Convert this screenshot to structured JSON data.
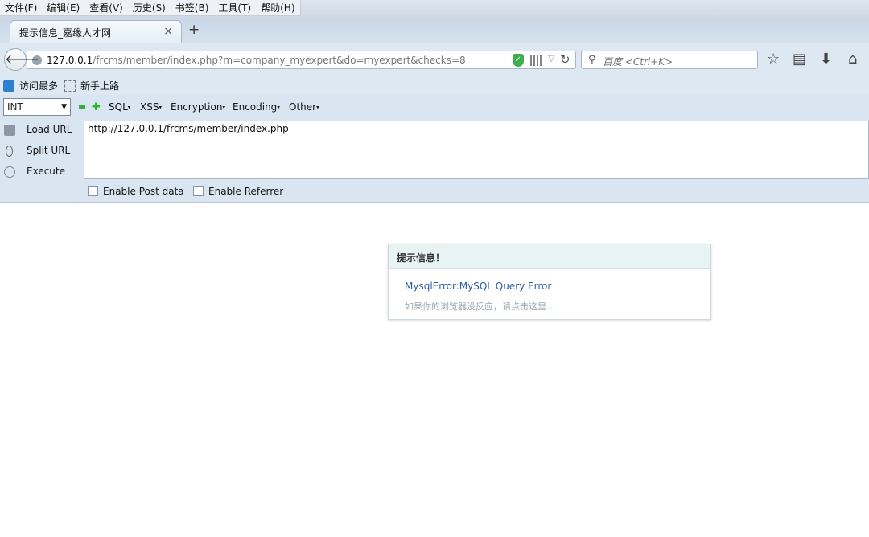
{
  "menubar": {
    "items": [
      "文件(F)",
      "编辑(E)",
      "查看(V)",
      "历史(S)",
      "书签(B)",
      "工具(T)",
      "帮助(H)"
    ]
  },
  "tab": {
    "title": "提示信息_嘉缘人才网",
    "close": "×",
    "new_tab": "+"
  },
  "navbar": {
    "url_host": "127.0.0.1",
    "url_path": "/frcms/member/index.php?m=company_myexpert&do=myexpert&checks=8",
    "search_placeholder": "百度 <Ctrl+K>"
  },
  "bookmarks": {
    "items": [
      "访问最多",
      "新手上路"
    ]
  },
  "hackbar": {
    "select_value": "INT",
    "menus": [
      "SQL",
      "XSS",
      "Encryption",
      "Encoding",
      "Other"
    ],
    "load_url": "Load URL",
    "split_url": "Split URL",
    "execute": "Execute",
    "url_value": "http://127.0.0.1/frcms/member/index.php",
    "enable_post": "Enable Post data",
    "enable_referrer": "Enable Referrer"
  },
  "dialog": {
    "title": "提示信息！",
    "message": "MysqlError:MySQL Query Error",
    "hint": "如果你的浏览器没反应，请点击这里..."
  },
  "colors": {
    "accent_link": "#2d5fa8",
    "shield_green": "#3fae49"
  }
}
